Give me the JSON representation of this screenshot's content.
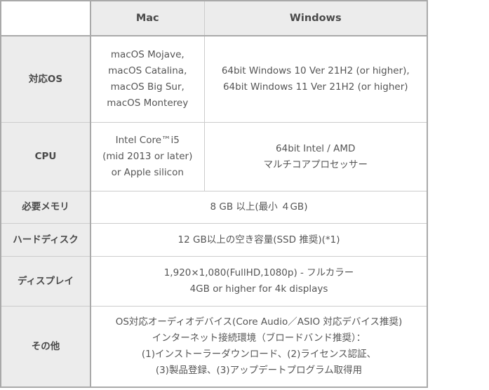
{
  "table": {
    "columns": {
      "label_header": "",
      "mac": "Mac",
      "windows": "Windows"
    },
    "rows": [
      {
        "label": "対応OS",
        "merged": false,
        "mac": [
          "macOS Mojave,",
          "macOS Catalina,",
          "macOS Big Sur,",
          "macOS Monterey"
        ],
        "windows": [
          "64bit Windows 10 Ver 21H2 (or higher),",
          "64bit Windows 11 Ver 21H2 (or higher)"
        ]
      },
      {
        "label": "CPU",
        "merged": false,
        "mac": [
          "Intel Core™i5",
          "(mid 2013 or later)",
          "or Apple silicon"
        ],
        "windows": [
          "64bit Intel / AMD",
          "マルチコアプロセッサー"
        ]
      },
      {
        "label": "必要メモリ",
        "merged": true,
        "value": [
          "8 GB 以上(最小 ４GB)"
        ]
      },
      {
        "label": "ハードディスク",
        "merged": true,
        "value": [
          "12 GB以上の空き容量(SSD 推奨)(*1)"
        ]
      },
      {
        "label": "ディスプレイ",
        "merged": true,
        "value": [
          "1,920×1,080(FullHD,1080p) - フルカラー",
          "4GB or higher for 4k displays"
        ]
      },
      {
        "label": "その他",
        "merged": true,
        "value": [
          "OS対応オーディオデバイス(Core Audio／ASIO 対応デバイス推奨)",
          "インターネット接続環境（ブロードバンド推奨）：",
          "(1)インストーラーダウンロード、(2)ライセンス認証、",
          "(3)製品登録、(3)アップデートプログラム取得用"
        ]
      }
    ]
  },
  "colors": {
    "header_bg": "#ececec",
    "label_bg": "#ececec",
    "cell_bg": "#ffffff",
    "outer_border": "#a9a9a9",
    "inner_border": "#cccccc",
    "text": "#555555",
    "page_bg": "#ffffff"
  }
}
